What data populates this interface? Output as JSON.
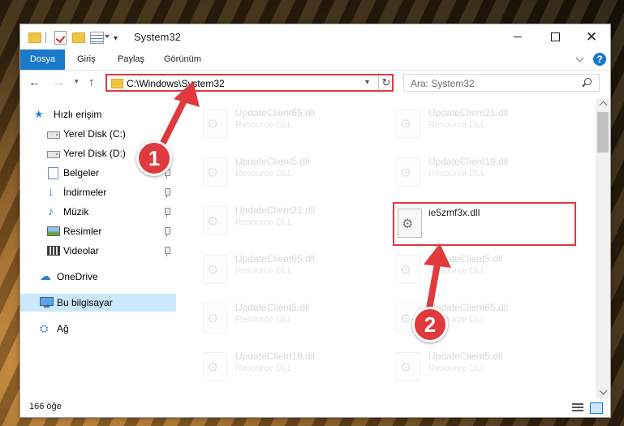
{
  "window": {
    "title": "System32",
    "controls": {
      "minimize": "",
      "maximize": "",
      "close": "✕"
    }
  },
  "ribbon": {
    "file_tab": "Dosya",
    "tabs": [
      "Giriş",
      "Paylaş",
      "Görünüm"
    ],
    "help": "?"
  },
  "nav": {
    "address": "C:\\Windows\\System32",
    "search_placeholder": "Ara: System32"
  },
  "sidebar": {
    "items": [
      {
        "label": "Hızlı erişim",
        "icon": "star-icon"
      },
      {
        "label": "Yerel Disk (C:)",
        "icon": "drive-icon"
      },
      {
        "label": "Yerel Disk (D:)",
        "icon": "drive-icon"
      },
      {
        "label": "Belgeler",
        "icon": "documents-icon",
        "pinned": true
      },
      {
        "label": "İndirmeler",
        "icon": "download-icon",
        "pinned": true
      },
      {
        "label": "Müzik",
        "icon": "music-icon",
        "pinned": true
      },
      {
        "label": "Resimler",
        "icon": "pictures-icon",
        "pinned": true
      },
      {
        "label": "Videolar",
        "icon": "videos-icon",
        "pinned": true
      },
      {
        "label": "OneDrive",
        "icon": "cloud-icon"
      },
      {
        "label": "Bu bilgisayar",
        "icon": "computer-icon",
        "selected": true
      },
      {
        "label": "Ağ",
        "icon": "network-icon"
      }
    ]
  },
  "files": {
    "left_column": [
      {
        "name": "UpdateClient65.dll",
        "type": "Resource DLL"
      },
      {
        "name": "UpdateClient5.dll",
        "type": "Resource DLL"
      },
      {
        "name": "UpdateClient21.dll",
        "type": "Resource DLL"
      },
      {
        "name": "UpdateClient65.dll",
        "type": "Resource DLL"
      },
      {
        "name": "UpdateClient5.dll",
        "type": "Resource DLL"
      },
      {
        "name": "UpdateClient19.dll",
        "type": "Resource DLL"
      }
    ],
    "right_column": [
      {
        "name": "UpdateClient21.dll",
        "type": "Resource DLL"
      },
      {
        "name": "UpdateClient19.dll",
        "type": "Resource DLL"
      },
      {
        "name": "ie5zmf3x.dll",
        "type": ""
      },
      {
        "name": "UpdateClient5.dll",
        "type": "Resource DLL"
      },
      {
        "name": "UpdateClient65.dll",
        "type": "Resource DLL"
      },
      {
        "name": "UpdateClient5.dll",
        "type": "Resource DLL"
      }
    ]
  },
  "status": {
    "count": "166 öğe"
  },
  "annotations": {
    "step1": "1",
    "step2": "2"
  },
  "colors": {
    "accent": "#1979ca",
    "highlight": "#e0393e",
    "selected": "#cce8ff"
  }
}
